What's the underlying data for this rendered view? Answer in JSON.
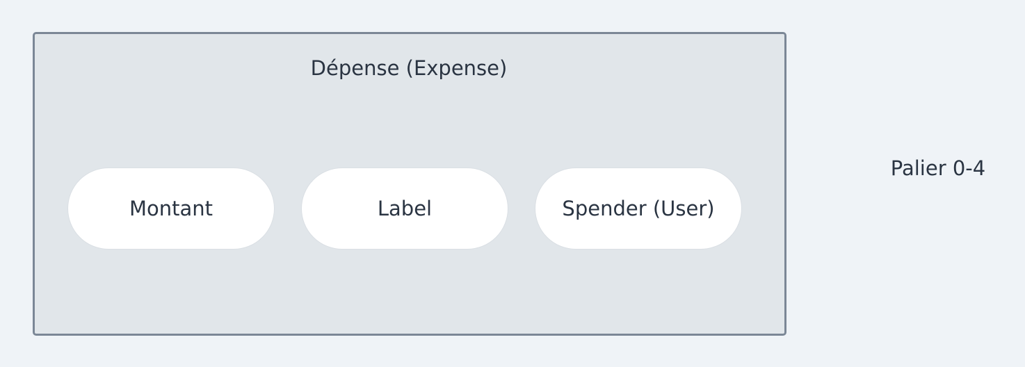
{
  "entity": {
    "title": "Dépense (Expense)",
    "attributes": [
      "Montant",
      "Label",
      "Spender (User)"
    ]
  },
  "tier_label": "Palier 0-4"
}
